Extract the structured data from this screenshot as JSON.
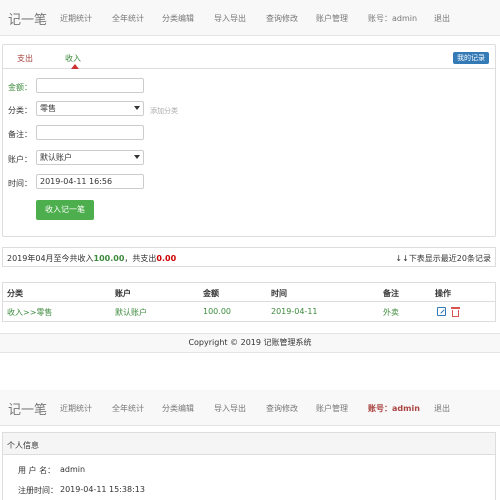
{
  "nav": {
    "brand": "记一笔",
    "items": [
      "近期统计",
      "全年统计",
      "分类编辑",
      "导入导出",
      "查询修改",
      "账户管理"
    ],
    "account": "账号：admin",
    "logout": "退出"
  },
  "form": {
    "tabs": [
      "支出",
      "收入"
    ],
    "active_tab": "收入",
    "history_button": "我的记录",
    "amount_label": "金额：",
    "amount_value": "",
    "category_label": "分类：",
    "category_value": "零售",
    "add_category": "添加分类",
    "note_label": "备注：",
    "note_value": "",
    "account_label": "账户：",
    "account_value": "默认账户",
    "time_label": "时间：",
    "time_value": "2019-04-11 16:56",
    "submit_label": "收入记一笔"
  },
  "summary": {
    "prefix": "2019年04月至今共收入",
    "income": "100.00",
    "mid": "，共支出",
    "expense": "0.00",
    "right": "↓↓下表显示最近20条记录"
  },
  "table": {
    "headers": [
      "分类",
      "账户",
      "金额",
      "时间",
      "备注",
      "操作"
    ],
    "rows": [
      {
        "category": "收入>>零售",
        "account": "默认账户",
        "amount": "100.00",
        "time": "2019-04-11",
        "note": "外卖"
      }
    ],
    "icons": {
      "edit": "edit-icon",
      "delete": "trash-icon"
    }
  },
  "footer": {
    "copyright": "Copyright © 2019 记账管理系统"
  },
  "nav2": {
    "brand": "记一笔",
    "items": [
      "近期统计",
      "全年统计",
      "分类编辑",
      "导入导出",
      "查询修改",
      "账户管理"
    ],
    "account": "账号：admin",
    "logout": "退出"
  },
  "profile": {
    "title": "个人信息",
    "username_label": "用 户 名：",
    "username": "admin",
    "registered_label": "注册时间：",
    "registered": "2019-04-11 15:38:13"
  },
  "colors": {
    "income": "#3c8a3c",
    "expense": "#cc0000",
    "primary": "#337ab7",
    "success": "#4cae4c"
  }
}
